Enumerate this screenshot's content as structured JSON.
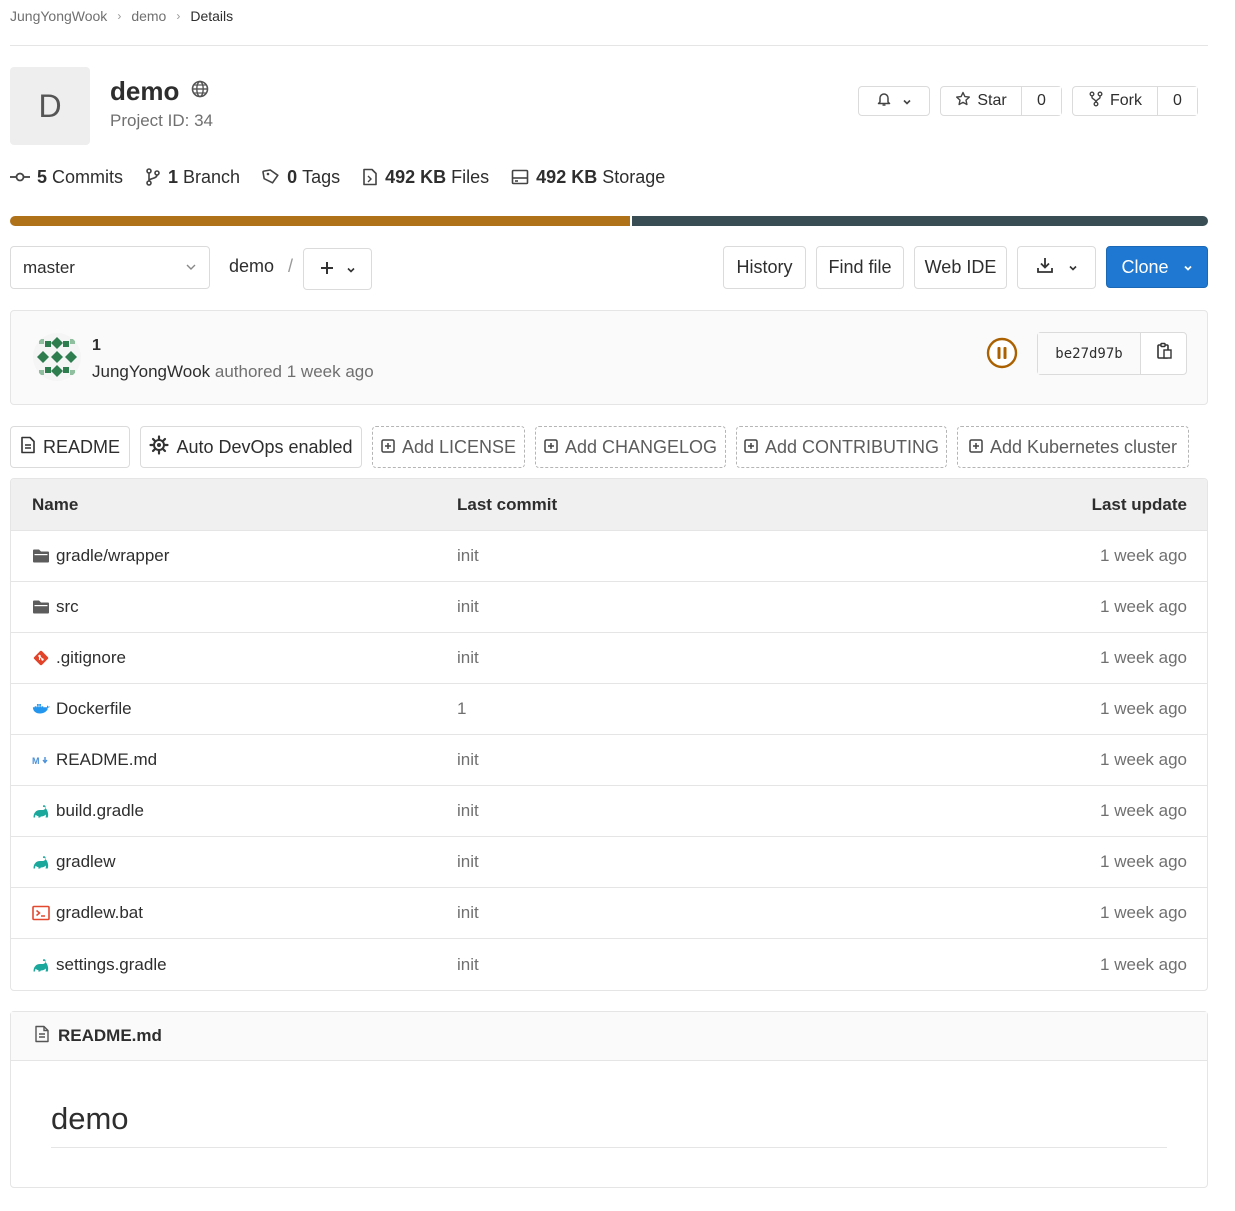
{
  "breadcrumb": {
    "owner": "JungYongWook",
    "project": "demo",
    "current": "Details"
  },
  "project": {
    "avatar_letter": "D",
    "name": "demo",
    "id_text": "Project ID: 34"
  },
  "actions": {
    "star_label": "Star",
    "star_count": "0",
    "fork_label": "Fork",
    "fork_count": "0"
  },
  "stats": {
    "commits_num": "5",
    "commits_label": "Commits",
    "branches_num": "1",
    "branches_label": "Branch",
    "tags_num": "0",
    "tags_label": "Tags",
    "files_num": "492 KB",
    "files_label": "Files",
    "storage_num": "492 KB",
    "storage_label": "Storage"
  },
  "language_bar": {
    "colors": [
      "#b07219",
      "#384d54"
    ]
  },
  "toolbar": {
    "branch": "master",
    "path_root": "demo",
    "path_sep": "/",
    "history": "History",
    "find_file": "Find file",
    "web_ide": "Web IDE",
    "clone": "Clone"
  },
  "commit": {
    "title": "1",
    "author": "JungYongWook",
    "authored": "authored",
    "time": "1 week ago",
    "sha": "be27d97b",
    "pipeline_status": "paused"
  },
  "quick_links": {
    "readme": "README",
    "autodevops": "Auto DevOps enabled",
    "license": "Add LICENSE",
    "changelog": "Add CHANGELOG",
    "contributing": "Add CONTRIBUTING",
    "kubernetes": "Add Kubernetes cluster"
  },
  "tree": {
    "headers": {
      "name": "Name",
      "last_commit": "Last commit",
      "last_update": "Last update"
    },
    "rows": [
      {
        "name": "gradle/wrapper",
        "icon": "folder-icon",
        "commit": "init",
        "updated": "1 week ago"
      },
      {
        "name": "src",
        "icon": "folder-icon",
        "commit": "init",
        "updated": "1 week ago"
      },
      {
        "name": ".gitignore",
        "icon": "git-icon",
        "commit": "init",
        "updated": "1 week ago"
      },
      {
        "name": "Dockerfile",
        "icon": "docker-icon",
        "commit": "1",
        "updated": "1 week ago"
      },
      {
        "name": "README.md",
        "icon": "markdown-icon",
        "commit": "init",
        "updated": "1 week ago"
      },
      {
        "name": "build.gradle",
        "icon": "gradle-icon",
        "commit": "init",
        "updated": "1 week ago"
      },
      {
        "name": "gradlew",
        "icon": "gradle-icon",
        "commit": "init",
        "updated": "1 week ago"
      },
      {
        "name": "gradlew.bat",
        "icon": "console-icon",
        "commit": "init",
        "updated": "1 week ago"
      },
      {
        "name": "settings.gradle",
        "icon": "gradle-icon",
        "commit": "init",
        "updated": "1 week ago"
      }
    ]
  },
  "readme": {
    "filename": "README.md",
    "heading": "demo"
  }
}
